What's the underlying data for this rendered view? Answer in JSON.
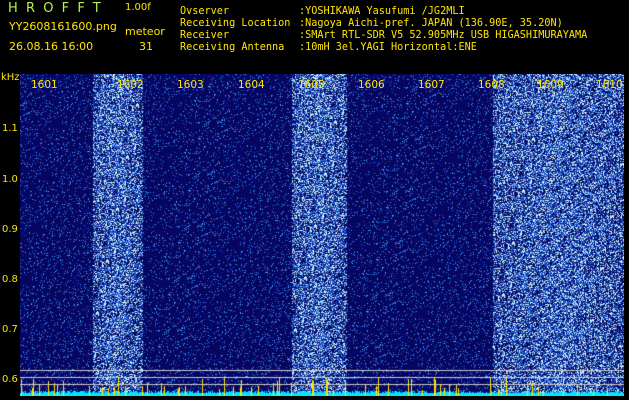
{
  "app": {
    "title": "HROFFT",
    "version": "1.00f"
  },
  "file": {
    "name": "YY2608161600.png",
    "datetime": "26.08.16 16:00"
  },
  "meteor": {
    "label": "meteor",
    "count": "31"
  },
  "info": [
    {
      "label": "Ovserver",
      "value": ":YOSHIKAWA Yasufumi /JG2MLI"
    },
    {
      "label": "Receiving Location",
      "value": ":Nagoya Aichi-pref. JAPAN (136.90E, 35.20N)"
    },
    {
      "label": "Receiver",
      "value": ":SMArt RTL-SDR V5 52.905MHz USB HIGASHIMURAYAMA"
    },
    {
      "label": "Receiving Antenna",
      "value": ":10mH 3el.YAGI Horizontal:ENE"
    }
  ],
  "axis": {
    "unit": "kHz",
    "y_ticks": [
      "1.1",
      "1.0",
      "0.9",
      "0.8",
      "0.7",
      "0.6"
    ],
    "minute_labels": [
      "1601",
      "1602",
      "1603",
      "1604",
      "1605",
      "1606",
      "1607",
      "1608",
      "1609",
      "1610"
    ]
  },
  "colors": {
    "background": "#000000",
    "text_primary": "#ffe600",
    "text_meta": "#b8f04a",
    "spectrum_base": "#0a0a6a",
    "baseline": "#00e5ff"
  }
}
